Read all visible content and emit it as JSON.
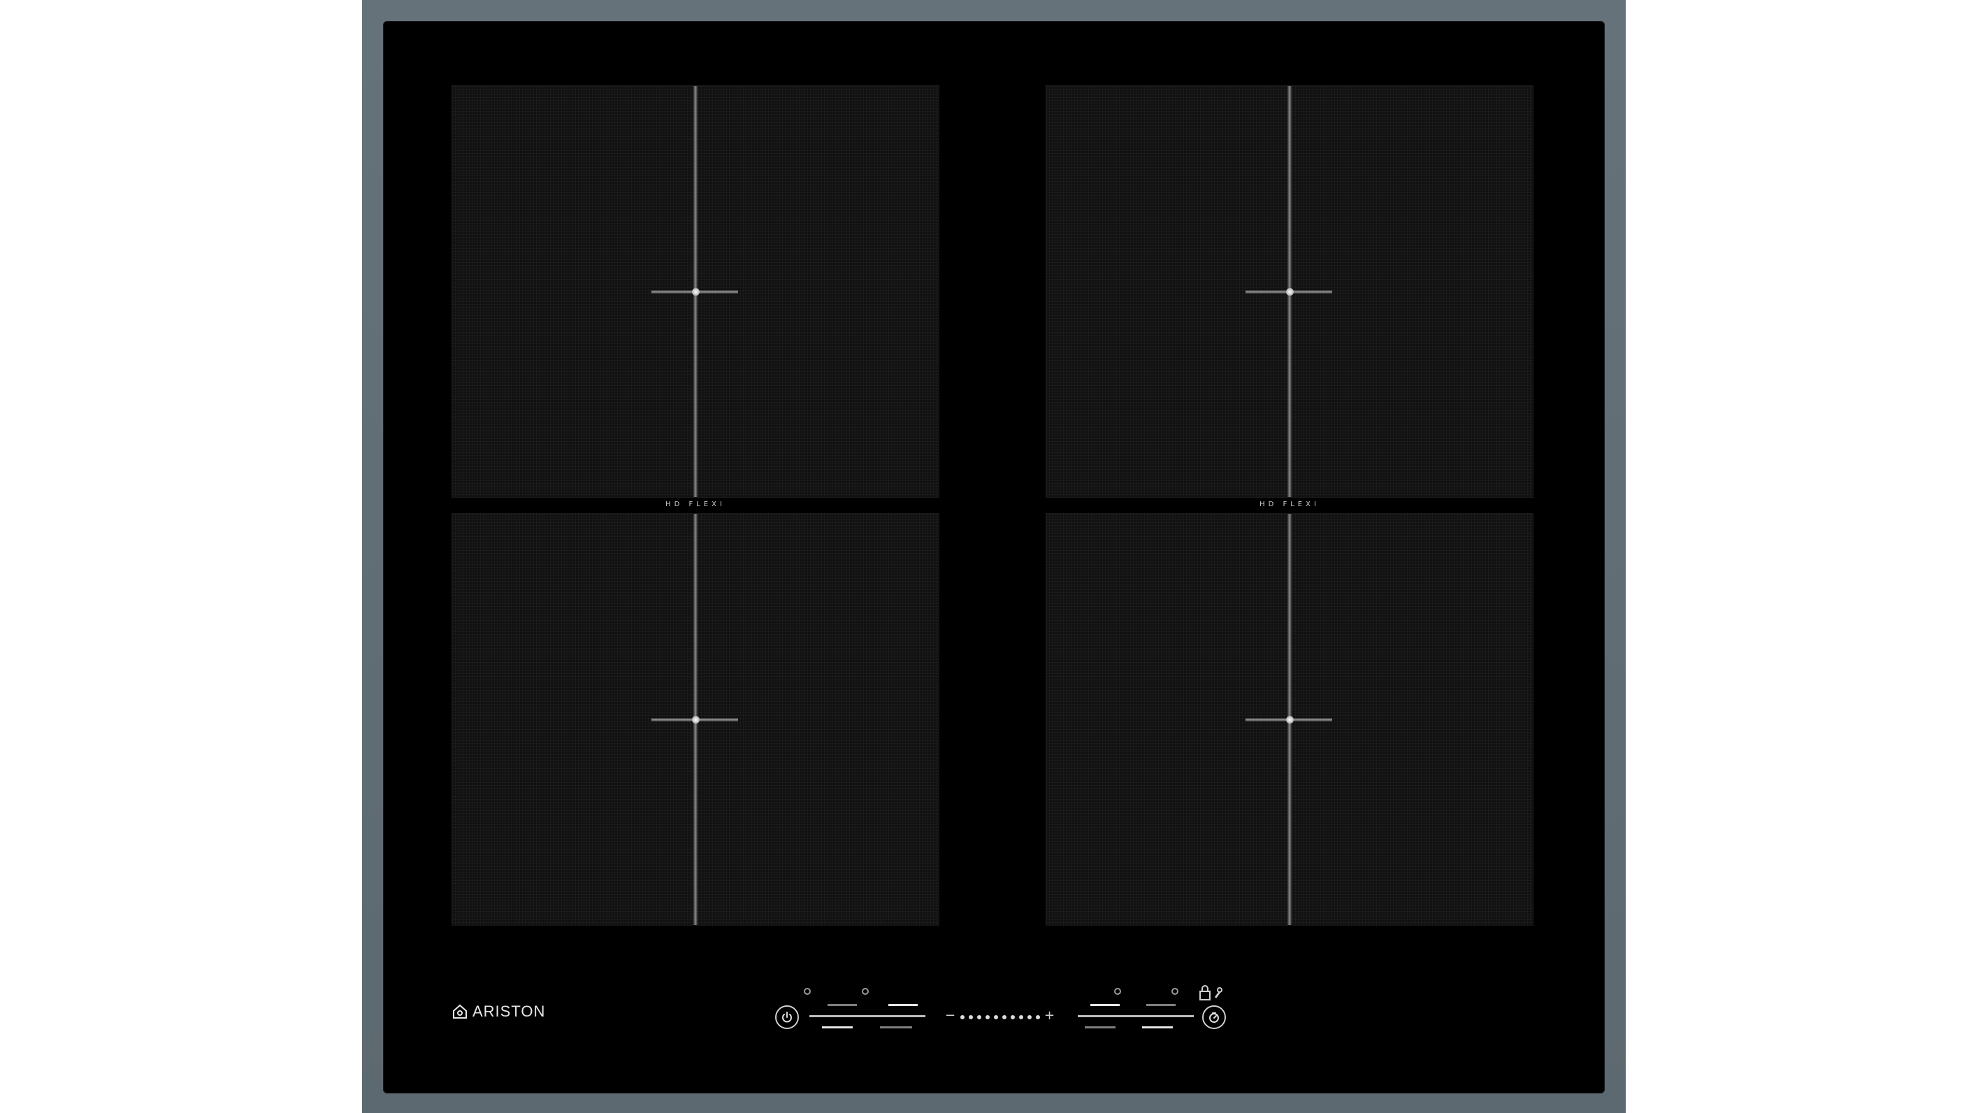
{
  "hob": {
    "zone_label": "HD FLEXI",
    "brand": "ARISTON",
    "icons": {
      "brand_logo": "ariston-house-logo",
      "power": "power-icon",
      "timer": "timer-icon",
      "lock": "lock-icon"
    },
    "slider": {
      "minus": "−",
      "plus": "+"
    }
  },
  "colors": {
    "frame": "#5f6b72",
    "glass": "#000000",
    "zone": "#111111",
    "accent": "#cfcfcf"
  }
}
